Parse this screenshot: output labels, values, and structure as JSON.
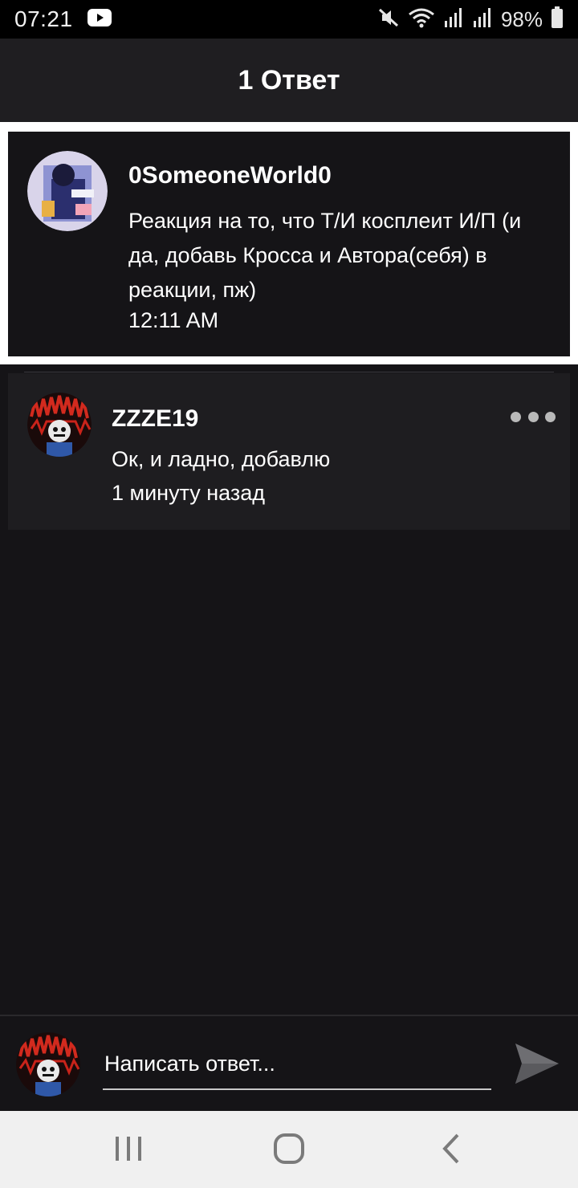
{
  "status_bar": {
    "time": "07:21",
    "battery": "98%",
    "icons": [
      "youtube-icon",
      "mute-icon",
      "wifi-icon",
      "signal-icon",
      "signal-icon",
      "battery-icon"
    ]
  },
  "header": {
    "title": "1 Ответ"
  },
  "parent_comment": {
    "username": "0SomeoneWorld0",
    "text": "Реакция на то, что Т/И косплеит И/П (и да, добавь Кросса и Автора(себя) в реакции, пж)",
    "time": "12:11 AM",
    "avatar_icon": "avatar-icon"
  },
  "reply": {
    "username": "ZZZE19",
    "text": "Ок, и ладно, добавлю",
    "time": "1 минуту назад",
    "avatar_icon": "avatar-icon",
    "more_icon": "more-horizontal-icon"
  },
  "composer": {
    "placeholder": "Написать ответ...",
    "send_icon": "send-icon"
  },
  "nav": {
    "icons": [
      "recent-apps-icon",
      "home-icon",
      "back-icon"
    ]
  },
  "colors": {
    "background": "#151417",
    "header": "#1f1e21",
    "reply_card": "#1e1d20",
    "highlight_frame": "#ffffff",
    "nav_bar": "#f0f0f0"
  }
}
